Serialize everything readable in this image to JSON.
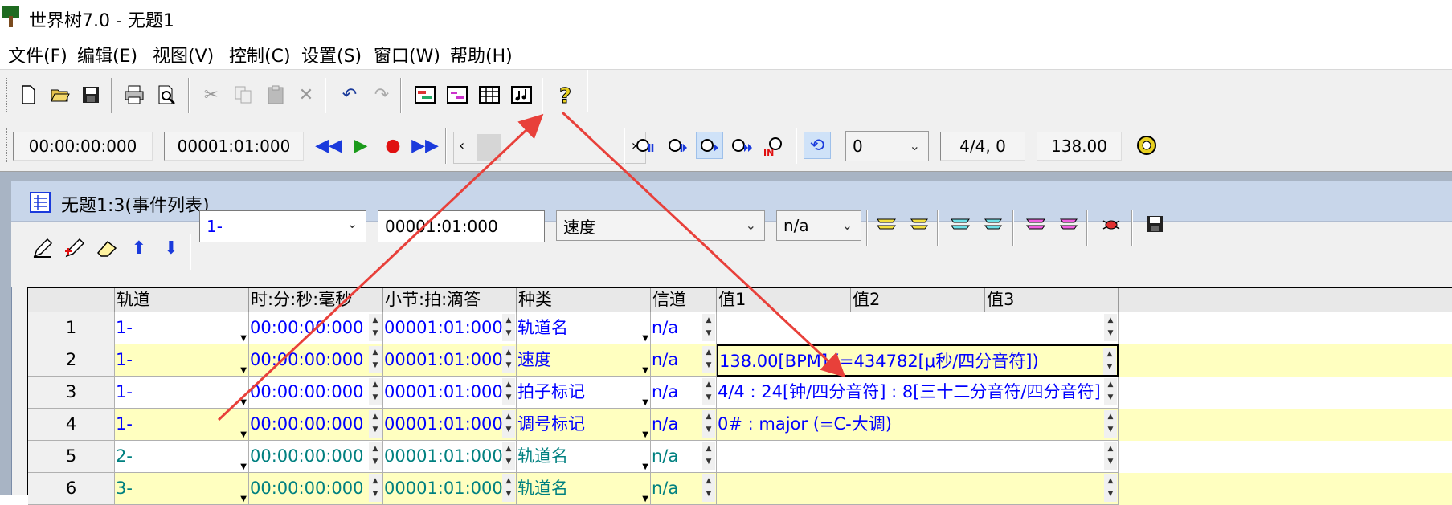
{
  "window": {
    "title": "世界树7.0 - 无题1"
  },
  "menu": [
    "文件(F)",
    "编辑(E)",
    "视图(V)",
    "控制(C)",
    "设置(S)",
    "窗口(W)",
    "帮助(H)"
  ],
  "transport": {
    "time": "00:00:00:000",
    "measure": "00001:01:000",
    "channel_value": "0",
    "beat": "4/4, 0",
    "tempo": "138.00"
  },
  "child_window": {
    "title": "无题1:3(事件列表)"
  },
  "event_toolbar": {
    "track_select": "1-",
    "position": "00001:01:000",
    "kind_select": "速度",
    "channel_select": "n/a"
  },
  "table": {
    "headers": [
      "",
      "轨道",
      "时:分:秒:毫秒",
      "小节:拍:滴答",
      "种类",
      "信道",
      "值1",
      "值2",
      "值3"
    ],
    "rows": [
      {
        "num": "1",
        "track": "1-",
        "time": "00:00:00:000",
        "measure": "00001:01:000",
        "kind": "轨道名",
        "channel": "n/a",
        "value1": "",
        "color": "blue"
      },
      {
        "num": "2",
        "track": "1-",
        "time": "00:00:00:000",
        "measure": "00001:01:000",
        "kind": "速度",
        "channel": "n/a",
        "value1": "138.00[BPM] (=434782[μ秒/四分音符])",
        "color": "blue"
      },
      {
        "num": "3",
        "track": "1-",
        "time": "00:00:00:000",
        "measure": "00001:01:000",
        "kind": "拍子标记",
        "channel": "n/a",
        "value1": "4/4 : 24[钟/四分音符] : 8[三十二分音符/四分音符]",
        "color": "blue"
      },
      {
        "num": "4",
        "track": "1-",
        "time": "00:00:00:000",
        "measure": "00001:01:000",
        "kind": "调号标记",
        "channel": "n/a",
        "value1": "0# : major (=C-大调)",
        "color": "blue"
      },
      {
        "num": "5",
        "track": "2-",
        "time": "00:00:00:000",
        "measure": "00001:01:000",
        "kind": "轨道名",
        "channel": "n/a",
        "value1": "",
        "color": "teal"
      },
      {
        "num": "6",
        "track": "3-",
        "time": "00:00:00:000",
        "measure": "00001:01:000",
        "kind": "轨道名",
        "channel": "n/a",
        "value1": "",
        "color": "teal"
      }
    ]
  },
  "colors": {
    "blue_text": "#0000ff",
    "teal_text": "#008080",
    "row_highlight": "#ffffc0",
    "annotation_arrow": "#e8403a"
  }
}
